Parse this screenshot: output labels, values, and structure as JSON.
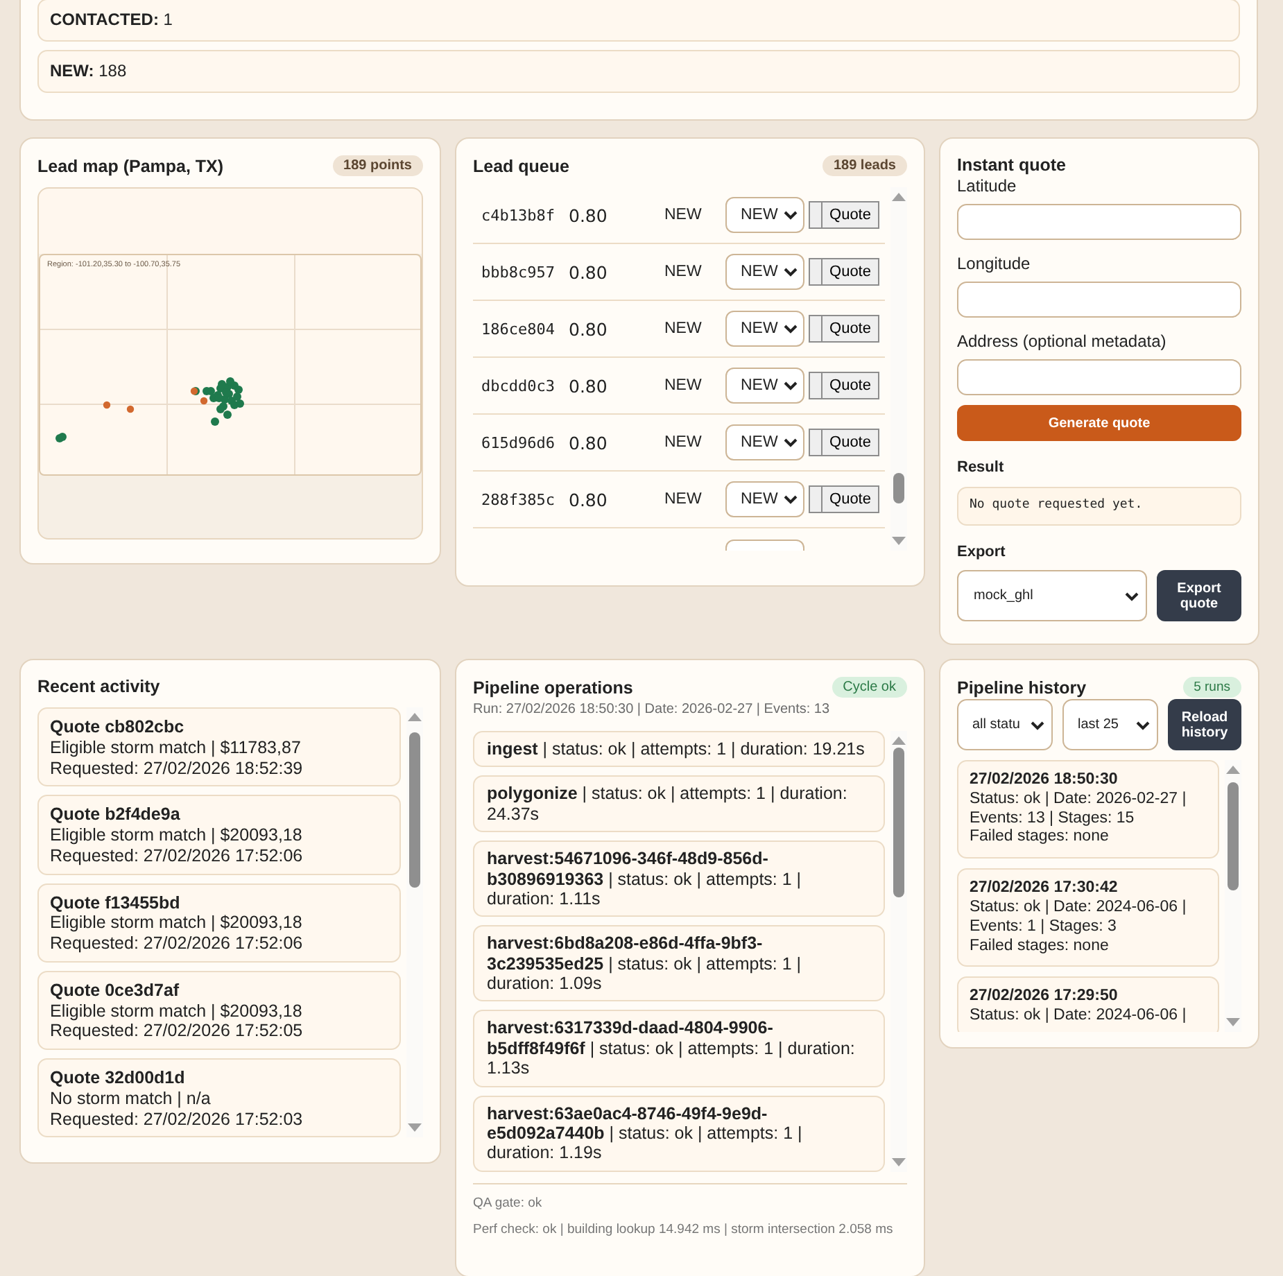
{
  "status_counts": [
    {
      "label": "CONTACTED:",
      "value": "1"
    },
    {
      "label": "NEW:",
      "value": "188"
    }
  ],
  "lead_map": {
    "title": "Lead map (Pampa, TX)",
    "badge": "189 points",
    "region": "Region: -101.20,35.30 to -100.70,35.75"
  },
  "lead_queue": {
    "title": "Lead queue",
    "badge": "189 leads",
    "rows": [
      {
        "id": "c4b13b8f",
        "score": "0.80",
        "status": "NEW",
        "select": "NEW",
        "action": "Quote"
      },
      {
        "id": "bbb8c957",
        "score": "0.80",
        "status": "NEW",
        "select": "NEW",
        "action": "Quote"
      },
      {
        "id": "186ce804",
        "score": "0.80",
        "status": "NEW",
        "select": "NEW",
        "action": "Quote"
      },
      {
        "id": "dbcdd0c3",
        "score": "0.80",
        "status": "NEW",
        "select": "NEW",
        "action": "Quote"
      },
      {
        "id": "615d96d6",
        "score": "0.80",
        "status": "NEW",
        "select": "NEW",
        "action": "Quote"
      },
      {
        "id": "288f385c",
        "score": "0.80",
        "status": "NEW",
        "select": "NEW",
        "action": "Quote"
      }
    ]
  },
  "instant_quote": {
    "title": "Instant quote",
    "fields": [
      {
        "label": "Latitude"
      },
      {
        "label": "Longitude"
      },
      {
        "label": "Address (optional metadata)"
      }
    ],
    "generate_button": "Generate quote",
    "result_label": "Result",
    "result": "No quote requested yet.",
    "export_label": "Export",
    "export_select": "mock_ghl",
    "export_button": "Export quote"
  },
  "recent_activity": {
    "title": "Recent activity",
    "items": [
      {
        "title": "Quote cb802cbc",
        "match": "Eligible storm match | $11783,87",
        "requested": "Requested: 27/02/2026 18:52:39"
      },
      {
        "title": "Quote b2f4de9a",
        "match": "Eligible storm match | $20093,18",
        "requested": "Requested: 27/02/2026 17:52:06"
      },
      {
        "title": "Quote f13455bd",
        "match": "Eligible storm match | $20093,18",
        "requested": "Requested: 27/02/2026 17:52:06"
      },
      {
        "title": "Quote 0ce3d7af",
        "match": "Eligible storm match | $20093,18",
        "requested": "Requested: 27/02/2026 17:52:05"
      },
      {
        "title": "Quote 32d00d1d",
        "match": "No storm match | n/a",
        "requested": "Requested: 27/02/2026 17:52:03"
      }
    ]
  },
  "pipeline_operations": {
    "title": "Pipeline operations",
    "badge": "Cycle ok",
    "meta": "Run: 27/02/2026 18:50:30 | Date: 2026-02-27 | Events: 13",
    "stages": [
      "**ingest** | status: ok | attempts: 1 | duration: 19.21s",
      "**polygonize** | status: ok | attempts: 1 | duration: 24.37s",
      "**harvest:54671096-346f-48d9-856d-b30896919363** | status: ok | attempts: 1 | duration: 1.11s",
      "**harvest:6bd8a208-e86d-4ffa-9bf3-3c239535ed25** | status: ok | attempts: 1 | duration: 1.09s",
      "**harvest:6317339d-daad-4804-9906-b5dff8f49f6f** | status: ok | attempts: 1 | duration: 1.13s",
      "**harvest:63ae0ac4-8746-49f4-9e9d-e5d092a7440b** | status: ok | attempts: 1 | duration: 1.19s"
    ],
    "qa_gate": "QA gate: ok",
    "perf_check": "Perf check: ok | building lookup 14.942 ms | storm intersection 2.058 ms"
  },
  "pipeline_history": {
    "title": "Pipeline history",
    "badge": "5 runs",
    "status_filter": "all statu",
    "limit_filter": "last 25",
    "reload_button": "Reload history",
    "runs": [
      {
        "time": "27/02/2026 18:50:30",
        "summary": "Status: ok | Date: 2026-02-27 | Events: 13 | Stages: 15",
        "failed": "Failed stages: none"
      },
      {
        "time": "27/02/2026 17:30:42",
        "summary": "Status: ok | Date: 2024-06-06 | Events: 1 | Stages: 3",
        "failed": "Failed stages: none"
      },
      {
        "time": "27/02/2026 17:29:50",
        "summary": "Status: ok | Date: 2024-06-06 |"
      }
    ]
  }
}
